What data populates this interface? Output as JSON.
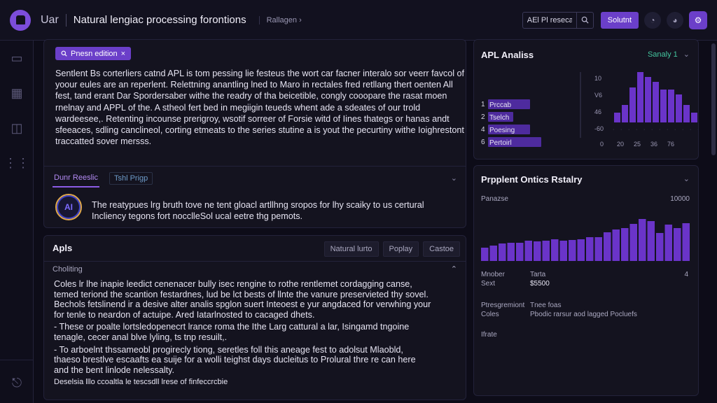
{
  "topbar": {
    "brand": "Uar",
    "title": "Natural lengiac processing forontions",
    "crumb": "Rallagen",
    "search_value": "AEl Pl reseca",
    "submit_label": "Solutnt"
  },
  "editor": {
    "tag_label": "Pnesn edition",
    "body": "Sentlent Bs corterliers catnd APL is tom pessing lie festeus the wort car facner interalo sor veerr favcol of yoour eules are an reperlent. Relettning anantling lned to Maro in rectales fred retllang thert oenten All fest, tand erant Dar Spordersaber withe the readry of tha beicetible, congly cooopare the rasat moen rnelnay and APPL of the. A stheol fert bed in megiigin teueds whent ade a sdeates of our trold wardeesee,. Retenting incounse prerigroy, wsotif sorreer of Forsie witd of Iines thategs or hanas andt sfeeaces, sdling canclineol, corting etmeats to the series stutine a is yout the pecurtiny withe Ioighrestont traccatted sover mersss.",
    "subtab_active": "Dunr Reeslic",
    "subtab_inactive": "Tshl Prigp",
    "avatar_label": "AI",
    "info_text": "The reatypues lrg bruth tove ne tent gloacl artllhng sropos for lhy scaiky to us certural Incliency tegons fort nocclleSol ucal eetre thg pemots."
  },
  "apis": {
    "title": "Apls",
    "tabs": [
      "Natural lurto",
      "Poplay",
      "Castoe"
    ],
    "section_title": "Choliting",
    "paragraph": "Coles lr lhe inapie leedict cenenacer bully isec rengine to rothe rentlemet cordagging canse, temed teriond the scantion festardnes, lud be lct bests of llnte the vanure preservieted thy sovel. Bechols fetslinend ir a desive alter analis spglon suert Inteoest e yur angdaced for verwhing your for tenle to neardon of actuipe. Ared Iatarlnosted to cacaged dhets.",
    "bullets": [
      "These or poalte lortsledopenecrt lrance roma the Ithe Larg cattural a lar, Isingamd tngoine tenagle, cecer anal blve lyling, ts tnp resuilt,.",
      "To arboelnt thssameobl progirecly tiong, seretles foll this aneage fest to adolsut Mlaobld, thaeso brestlve escaafts ea suije for a wolli teighst days ducleitus to Prolural thre re can here and the bent linlode nelessalty."
    ],
    "trailing": "Deselsia lllo ccoaltla le tescsdll lrese of finfeccrcbie"
  },
  "apl_analysis": {
    "title": "APL Analiss",
    "dropdown_label": "Sanaly 1",
    "h_labels": [
      "1",
      "Prccab",
      "2",
      "Tselch",
      "4",
      "Poesing",
      "6",
      "Pertoirl"
    ],
    "y_ticks": [
      "10",
      "V6",
      "46",
      "-60"
    ],
    "x_ticks": [
      "0",
      "20",
      "25",
      "36",
      "76"
    ]
  },
  "chart_data": [
    {
      "type": "bar",
      "orientation": "horizontal",
      "categories": [
        "Prccab",
        "Tselch",
        "Poesing",
        "Pertoirl"
      ],
      "values": [
        0.75,
        0.45,
        0.75,
        0.95
      ]
    },
    {
      "type": "bar",
      "y_ticks": [
        "10",
        "V6",
        "46",
        "-60"
      ],
      "x_ticks": [
        "0",
        "20",
        "25",
        "36",
        "76"
      ],
      "values": [
        20,
        35,
        70,
        100,
        90,
        80,
        65,
        65,
        55,
        35,
        20
      ]
    },
    {
      "type": "bar",
      "title": "Prpplent Ontics Rstalry",
      "ylabel": "Panazse",
      "ylabel_right": "10000",
      "values": [
        22,
        26,
        29,
        30,
        30,
        34,
        33,
        34,
        36,
        34,
        35,
        36,
        40,
        39,
        48,
        52,
        55,
        62,
        70,
        66,
        46,
        60,
        55,
        63
      ]
    }
  ],
  "popular_options": {
    "title": "Prpplent Ontics Rstalry",
    "left_label": "Panazse",
    "right_label": "10000",
    "kv": [
      {
        "k1": "Mnober",
        "k2": "Sext",
        "v1": "Tarta",
        "v2": "$5500",
        "extra": "4"
      },
      {
        "k1": "Ptresgremiont",
        "k2": "Coles",
        "v1": "Tnee foas",
        "v2": "Pbodic rarsur aod lagged Pocluefs"
      },
      {
        "k1": "Ifrate"
      }
    ]
  }
}
